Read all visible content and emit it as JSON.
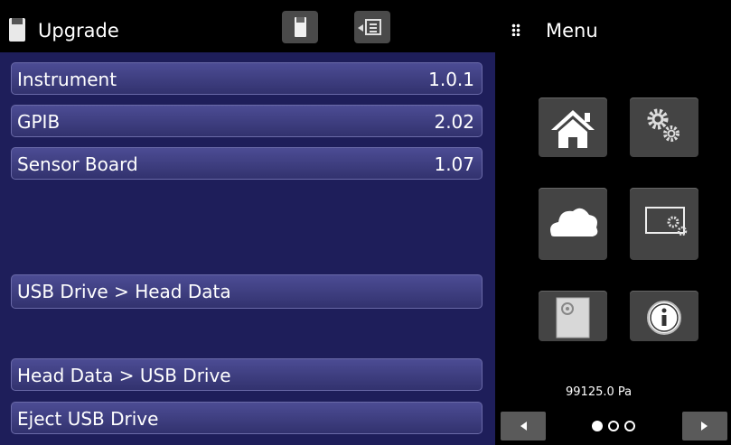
{
  "header": {
    "title": "Upgrade"
  },
  "rows": [
    {
      "label": "Instrument",
      "value": "1.0.1"
    },
    {
      "label": "GPIB",
      "value": "2.02"
    },
    {
      "label": "Sensor Board",
      "value": "1.07"
    }
  ],
  "actions": {
    "usb_to_head": "USB Drive > Head Data",
    "head_to_usb": "Head Data > USB Drive",
    "eject": "Eject USB Drive"
  },
  "menu": {
    "title": "Menu",
    "tiles": [
      "home-icon",
      "settings-icon",
      "cloud-icon",
      "display-settings-icon",
      "storage-icon",
      "info-icon"
    ],
    "pressure_readout": "99125.0 Pa",
    "page_indicator": {
      "current": 1,
      "total": 3
    }
  },
  "colors": {
    "panel": "#1e1e5a",
    "row_top": "#4c4c94",
    "row_bottom": "#32326e",
    "tile": "#444444"
  }
}
